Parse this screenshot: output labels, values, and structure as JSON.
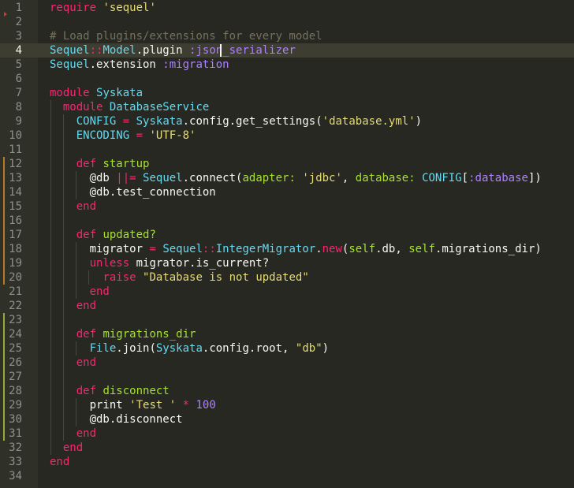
{
  "editor": {
    "language": "ruby",
    "active_line": 4,
    "colors": {
      "background": "#272822",
      "gutter": "#2f3129",
      "active_line": "#3e3d32",
      "keyword": "#f92672",
      "string": "#e6db74",
      "comment": "#75715e",
      "constant": "#66d9ef",
      "symbol": "#ae81ff",
      "function": "#a6e22e",
      "modified_marker": "#b5792a",
      "added_marker": "#9aa83a"
    },
    "lines": [
      {
        "n": "1",
        "tokens": [
          {
            "t": "kw",
            "v": "require"
          },
          {
            "t": "plain",
            "v": " "
          },
          {
            "t": "str",
            "v": "'sequel'"
          }
        ]
      },
      {
        "n": "2",
        "tokens": []
      },
      {
        "n": "3",
        "tokens": [
          {
            "t": "cmt",
            "v": "# Load plugins/extensions for every model"
          }
        ]
      },
      {
        "n": "4",
        "tokens": [
          {
            "t": "cls",
            "v": "Sequel"
          },
          {
            "t": "op",
            "v": "::"
          },
          {
            "t": "cls",
            "v": "Model"
          },
          {
            "t": "plain",
            "v": ".plugin "
          },
          {
            "t": "sym",
            "v": ":json_serializer"
          }
        ]
      },
      {
        "n": "5",
        "tokens": [
          {
            "t": "cls",
            "v": "Sequel"
          },
          {
            "t": "plain",
            "v": ".extension "
          },
          {
            "t": "sym",
            "v": ":migration"
          }
        ]
      },
      {
        "n": "6",
        "tokens": []
      },
      {
        "n": "7",
        "tokens": [
          {
            "t": "kw",
            "v": "module"
          },
          {
            "t": "plain",
            "v": " "
          },
          {
            "t": "cls",
            "v": "Syskata"
          }
        ]
      },
      {
        "n": "8",
        "tokens": [
          {
            "t": "plain",
            "v": "  "
          },
          {
            "t": "kw",
            "v": "module"
          },
          {
            "t": "plain",
            "v": " "
          },
          {
            "t": "cls",
            "v": "DatabaseService"
          }
        ]
      },
      {
        "n": "9",
        "tokens": [
          {
            "t": "plain",
            "v": "    "
          },
          {
            "t": "cls",
            "v": "CONFIG"
          },
          {
            "t": "plain",
            "v": " "
          },
          {
            "t": "op",
            "v": "="
          },
          {
            "t": "plain",
            "v": " "
          },
          {
            "t": "cls",
            "v": "Syskata"
          },
          {
            "t": "plain",
            "v": ".config.get_settings("
          },
          {
            "t": "str",
            "v": "'database.yml'"
          },
          {
            "t": "plain",
            "v": ")"
          }
        ]
      },
      {
        "n": "10",
        "tokens": [
          {
            "t": "plain",
            "v": "    "
          },
          {
            "t": "cls",
            "v": "ENCODING"
          },
          {
            "t": "plain",
            "v": " "
          },
          {
            "t": "op",
            "v": "="
          },
          {
            "t": "plain",
            "v": " "
          },
          {
            "t": "str",
            "v": "'UTF-8'"
          }
        ]
      },
      {
        "n": "11",
        "tokens": []
      },
      {
        "n": "12",
        "tokens": [
          {
            "t": "plain",
            "v": "    "
          },
          {
            "t": "kw",
            "v": "def"
          },
          {
            "t": "plain",
            "v": " "
          },
          {
            "t": "fn",
            "v": "startup"
          }
        ]
      },
      {
        "n": "13",
        "tokens": [
          {
            "t": "plain",
            "v": "      @db "
          },
          {
            "t": "op",
            "v": "||="
          },
          {
            "t": "plain",
            "v": " "
          },
          {
            "t": "cls",
            "v": "Sequel"
          },
          {
            "t": "plain",
            "v": ".connect("
          },
          {
            "t": "fn",
            "v": "adapter:"
          },
          {
            "t": "plain",
            "v": " "
          },
          {
            "t": "str",
            "v": "'jdbc'"
          },
          {
            "t": "plain",
            "v": ", "
          },
          {
            "t": "fn",
            "v": "database:"
          },
          {
            "t": "plain",
            "v": " "
          },
          {
            "t": "cls",
            "v": "CONFIG"
          },
          {
            "t": "plain",
            "v": "["
          },
          {
            "t": "sym",
            "v": ":database"
          },
          {
            "t": "plain",
            "v": "])"
          }
        ]
      },
      {
        "n": "14",
        "tokens": [
          {
            "t": "plain",
            "v": "      @db.test_connection"
          }
        ]
      },
      {
        "n": "15",
        "tokens": [
          {
            "t": "plain",
            "v": "    "
          },
          {
            "t": "kw",
            "v": "end"
          }
        ]
      },
      {
        "n": "16",
        "tokens": []
      },
      {
        "n": "17",
        "tokens": [
          {
            "t": "plain",
            "v": "    "
          },
          {
            "t": "kw",
            "v": "def"
          },
          {
            "t": "plain",
            "v": " "
          },
          {
            "t": "fn",
            "v": "updated?"
          }
        ]
      },
      {
        "n": "18",
        "tokens": [
          {
            "t": "plain",
            "v": "      migrator "
          },
          {
            "t": "op",
            "v": "="
          },
          {
            "t": "plain",
            "v": " "
          },
          {
            "t": "cls",
            "v": "Sequel"
          },
          {
            "t": "op",
            "v": "::"
          },
          {
            "t": "cls",
            "v": "IntegerMigrator"
          },
          {
            "t": "plain",
            "v": "."
          },
          {
            "t": "kw",
            "v": "new"
          },
          {
            "t": "plain",
            "v": "("
          },
          {
            "t": "fn",
            "v": "self"
          },
          {
            "t": "plain",
            "v": ".db, "
          },
          {
            "t": "fn",
            "v": "self"
          },
          {
            "t": "plain",
            "v": ".migrations_dir)"
          }
        ]
      },
      {
        "n": "19",
        "tokens": [
          {
            "t": "plain",
            "v": "      "
          },
          {
            "t": "kw",
            "v": "unless"
          },
          {
            "t": "plain",
            "v": " migrator.is_current?"
          }
        ]
      },
      {
        "n": "20",
        "tokens": [
          {
            "t": "plain",
            "v": "        "
          },
          {
            "t": "kw",
            "v": "raise"
          },
          {
            "t": "plain",
            "v": " "
          },
          {
            "t": "str",
            "v": "\"Database is not updated\""
          }
        ]
      },
      {
        "n": "21",
        "tokens": [
          {
            "t": "plain",
            "v": "      "
          },
          {
            "t": "kw",
            "v": "end"
          }
        ]
      },
      {
        "n": "22",
        "tokens": [
          {
            "t": "plain",
            "v": "    "
          },
          {
            "t": "kw",
            "v": "end"
          }
        ]
      },
      {
        "n": "23",
        "tokens": []
      },
      {
        "n": "24",
        "tokens": [
          {
            "t": "plain",
            "v": "    "
          },
          {
            "t": "kw",
            "v": "def"
          },
          {
            "t": "plain",
            "v": " "
          },
          {
            "t": "fn",
            "v": "migrations_dir"
          }
        ]
      },
      {
        "n": "25",
        "tokens": [
          {
            "t": "plain",
            "v": "      "
          },
          {
            "t": "cls",
            "v": "File"
          },
          {
            "t": "plain",
            "v": ".join("
          },
          {
            "t": "cls",
            "v": "Syskata"
          },
          {
            "t": "plain",
            "v": ".config.root, "
          },
          {
            "t": "str",
            "v": "\"db\""
          },
          {
            "t": "plain",
            "v": ")"
          }
        ]
      },
      {
        "n": "26",
        "tokens": [
          {
            "t": "plain",
            "v": "    "
          },
          {
            "t": "kw",
            "v": "end"
          }
        ]
      },
      {
        "n": "27",
        "tokens": []
      },
      {
        "n": "28",
        "tokens": [
          {
            "t": "plain",
            "v": "    "
          },
          {
            "t": "kw",
            "v": "def"
          },
          {
            "t": "plain",
            "v": " "
          },
          {
            "t": "fn",
            "v": "disconnect"
          }
        ]
      },
      {
        "n": "29",
        "tokens": [
          {
            "t": "plain",
            "v": "      print "
          },
          {
            "t": "str",
            "v": "'Test '"
          },
          {
            "t": "plain",
            "v": " "
          },
          {
            "t": "op",
            "v": "*"
          },
          {
            "t": "plain",
            "v": " "
          },
          {
            "t": "num",
            "v": "100"
          }
        ]
      },
      {
        "n": "30",
        "tokens": [
          {
            "t": "plain",
            "v": "      @db.disconnect"
          }
        ]
      },
      {
        "n": "31",
        "tokens": [
          {
            "t": "plain",
            "v": "    "
          },
          {
            "t": "kw",
            "v": "end"
          }
        ]
      },
      {
        "n": "32",
        "tokens": [
          {
            "t": "plain",
            "v": "  "
          },
          {
            "t": "kw",
            "v": "end"
          }
        ]
      },
      {
        "n": "33",
        "tokens": [
          {
            "t": "kw",
            "v": "end"
          }
        ]
      },
      {
        "n": "34",
        "tokens": []
      }
    ]
  }
}
